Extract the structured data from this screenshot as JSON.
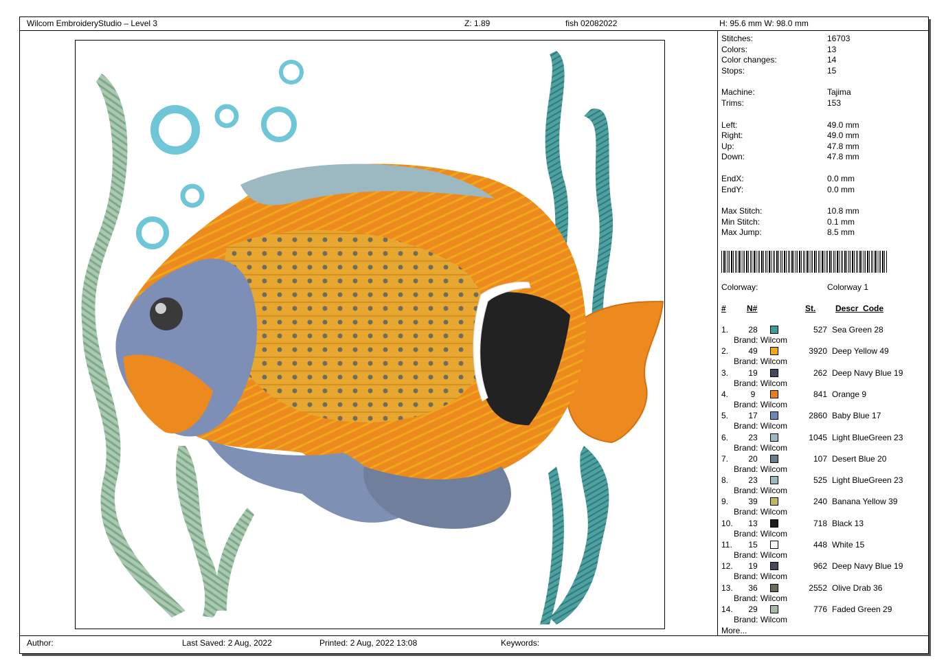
{
  "header": {
    "app_title": "Wilcom EmbroideryStudio – Level 3",
    "zoom": "Z: 1.89",
    "file_name": "fish 02082022",
    "dimensions": "H: 95.6 mm   W: 98.0 mm"
  },
  "stats": [
    {
      "label": "Stitches:",
      "value": "16703"
    },
    {
      "label": "Colors:",
      "value": "13"
    },
    {
      "label": "Color changes:",
      "value": "14"
    },
    {
      "label": "Stops:",
      "value": "15"
    },
    {
      "label": "Machine:",
      "value": "Tajima"
    },
    {
      "label": "Trims:",
      "value": "153"
    },
    {
      "label": "Left:",
      "value": "49.0 mm"
    },
    {
      "label": "Right:",
      "value": "49.0 mm"
    },
    {
      "label": "Up:",
      "value": "47.8 mm"
    },
    {
      "label": "Down:",
      "value": "47.8 mm"
    },
    {
      "label": "EndX:",
      "value": "0.0 mm"
    },
    {
      "label": "EndY:",
      "value": "0.0 mm"
    },
    {
      "label": "Max Stitch:",
      "value": "10.8 mm"
    },
    {
      "label": "Min Stitch:",
      "value": "0.1 mm"
    },
    {
      "label": "Max Jump:",
      "value": "8.5 mm"
    }
  ],
  "colorway": {
    "label": "Colorway:",
    "value": "Colorway 1"
  },
  "table_headers": {
    "idx": "#",
    "num": "N#",
    "stitches": "St.",
    "descr": "Descr_Code"
  },
  "threads": [
    {
      "idx": "1.",
      "num": "28",
      "color": "#3f9a9a",
      "stitches": "527",
      "descr": "Sea Green 28",
      "brand": "Brand: Wilcom"
    },
    {
      "idx": "2.",
      "num": "49",
      "color": "#f0a818",
      "stitches": "3920",
      "descr": "Deep Yellow 49",
      "brand": "Brand: Wilcom"
    },
    {
      "idx": "3.",
      "num": "19",
      "color": "#444a5c",
      "stitches": "262",
      "descr": "Deep Navy Blue 19",
      "brand": "Brand: Wilcom"
    },
    {
      "idx": "4.",
      "num": "9",
      "color": "#ec7e1a",
      "stitches": "841",
      "descr": "Orange 9",
      "brand": "Brand: Wilcom"
    },
    {
      "idx": "5.",
      "num": "17",
      "color": "#6c86b8",
      "stitches": "2860",
      "descr": "Baby Blue 17",
      "brand": "Brand: Wilcom"
    },
    {
      "idx": "6.",
      "num": "23",
      "color": "#9cb8c0",
      "stitches": "1045",
      "descr": "Light BlueGreen 23",
      "brand": "Brand: Wilcom"
    },
    {
      "idx": "7.",
      "num": "20",
      "color": "#6a7c92",
      "stitches": "107",
      "descr": "Desert Blue 20",
      "brand": "Brand: Wilcom"
    },
    {
      "idx": "8.",
      "num": "23",
      "color": "#9cb8c0",
      "stitches": "525",
      "descr": "Light BlueGreen 23",
      "brand": "Brand: Wilcom"
    },
    {
      "idx": "9.",
      "num": "39",
      "color": "#c2b860",
      "stitches": "240",
      "descr": "Banana Yellow 39",
      "brand": "Brand: Wilcom"
    },
    {
      "idx": "10.",
      "num": "13",
      "color": "#1c1c1c",
      "stitches": "718",
      "descr": "Black 13",
      "brand": "Brand: Wilcom"
    },
    {
      "idx": "11.",
      "num": "15",
      "color": "#ffffff",
      "stitches": "448",
      "descr": "White 15",
      "brand": "Brand: Wilcom"
    },
    {
      "idx": "12.",
      "num": "19",
      "color": "#444a5c",
      "stitches": "962",
      "descr": "Deep Navy Blue 19",
      "brand": "Brand: Wilcom"
    },
    {
      "idx": "13.",
      "num": "36",
      "color": "#6a6a5c",
      "stitches": "2552",
      "descr": "Olive Drab 36",
      "brand": "Brand: Wilcom"
    },
    {
      "idx": "14.",
      "num": "29",
      "color": "#a8b8a8",
      "stitches": "776",
      "descr": "Faded Green 29",
      "brand": "Brand: Wilcom"
    }
  ],
  "more_label": "More...",
  "footer": {
    "author": "Author:",
    "last_saved": "Last Saved:  2 Aug, 2022",
    "printed": "Printed:  2 Aug, 2022 13:08",
    "keywords": "Keywords:"
  }
}
